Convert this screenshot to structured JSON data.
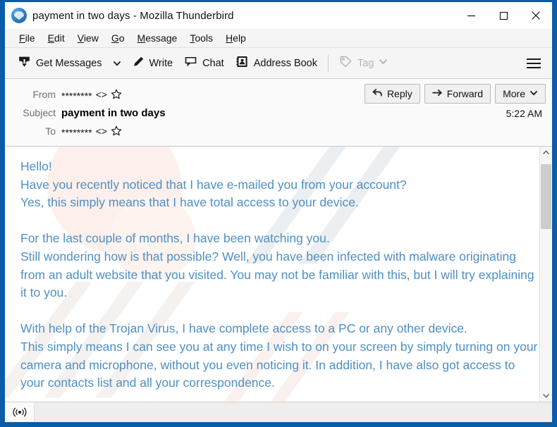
{
  "window": {
    "title": "payment in two days - Mozilla Thunderbird",
    "app_icon": "thunderbird-logo-icon",
    "accent_border_color": "#0a5ca8",
    "controls": {
      "minimize": "minimize-icon",
      "maximize": "maximize-icon",
      "close": "close-icon"
    }
  },
  "menubar": {
    "items": [
      {
        "label": "File",
        "accesskey": "F"
      },
      {
        "label": "Edit",
        "accesskey": "E"
      },
      {
        "label": "View",
        "accesskey": "V"
      },
      {
        "label": "Go",
        "accesskey": "G"
      },
      {
        "label": "Message",
        "accesskey": "M"
      },
      {
        "label": "Tools",
        "accesskey": "T"
      },
      {
        "label": "Help",
        "accesskey": "H"
      }
    ]
  },
  "toolbar": {
    "get_messages_label": "Get Messages",
    "get_messages_icon": "inbox-download-icon",
    "get_messages_caret": "chevron-down-icon",
    "write_label": "Write",
    "write_icon": "pencil-icon",
    "chat_label": "Chat",
    "chat_icon": "speech-bubble-icon",
    "address_book_label": "Address Book",
    "address_book_icon": "address-book-icon",
    "tag_label": "Tag",
    "tag_icon": "tag-icon",
    "tag_caret": "chevron-down-icon",
    "tag_disabled": true,
    "menu_button_icon": "hamburger-menu-icon"
  },
  "message_header": {
    "from_label": "From",
    "from_value": "********",
    "from_brackets": "<>",
    "subject_label": "Subject",
    "subject_value": "payment in two days",
    "to_label": "To",
    "to_value": "********",
    "to_brackets": "<>",
    "star_icon": "star-outline-icon",
    "time": "5:22 AM",
    "actions": {
      "reply_label": "Reply",
      "reply_icon": "reply-arrow-icon",
      "forward_label": "Forward",
      "forward_icon": "forward-arrow-icon",
      "more_label": "More",
      "more_caret": "chevron-down-icon"
    }
  },
  "message_body": {
    "text_color": "#4f8fc4",
    "paragraphs": [
      "Hello!",
      "Have you recently noticed that I have e-mailed you from your account?",
      "Yes, this simply means that I have total access to your device.",
      "",
      "For the last couple of months, I have been watching you.",
      "Still wondering how is that possible? Well, you have been infected with malware originating from an adult website that you visited. You may not be familiar with this, but I will try explaining it to you.",
      "",
      "With help of the Trojan Virus, I have complete access to a PC or any other device.",
      "This simply means I can see you at any time I wish to on your screen by simply turning on your camera and microphone, without you even noticing it. In addition, I have also got access to your contacts list and all your correspondence."
    ]
  },
  "scrollbar": {
    "up_arrow_icon": "chevron-up-icon",
    "down_arrow_icon": "chevron-down-icon"
  },
  "statusbar": {
    "icon": "broadcast-signal-icon",
    "text": ""
  }
}
